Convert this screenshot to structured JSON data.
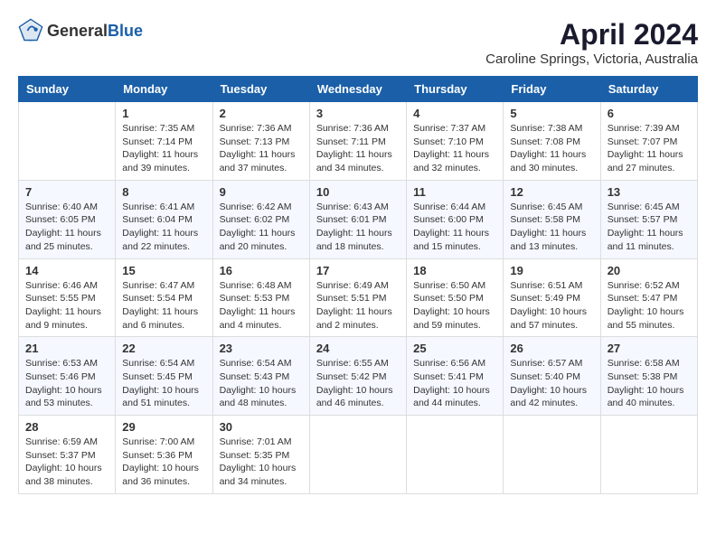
{
  "header": {
    "logo_general": "General",
    "logo_blue": "Blue",
    "month_title": "April 2024",
    "location": "Caroline Springs, Victoria, Australia"
  },
  "days_of_week": [
    "Sunday",
    "Monday",
    "Tuesday",
    "Wednesday",
    "Thursday",
    "Friday",
    "Saturday"
  ],
  "weeks": [
    [
      {
        "day": "",
        "content": ""
      },
      {
        "day": "1",
        "content": "Sunrise: 7:35 AM\nSunset: 7:14 PM\nDaylight: 11 hours\nand 39 minutes."
      },
      {
        "day": "2",
        "content": "Sunrise: 7:36 AM\nSunset: 7:13 PM\nDaylight: 11 hours\nand 37 minutes."
      },
      {
        "day": "3",
        "content": "Sunrise: 7:36 AM\nSunset: 7:11 PM\nDaylight: 11 hours\nand 34 minutes."
      },
      {
        "day": "4",
        "content": "Sunrise: 7:37 AM\nSunset: 7:10 PM\nDaylight: 11 hours\nand 32 minutes."
      },
      {
        "day": "5",
        "content": "Sunrise: 7:38 AM\nSunset: 7:08 PM\nDaylight: 11 hours\nand 30 minutes."
      },
      {
        "day": "6",
        "content": "Sunrise: 7:39 AM\nSunset: 7:07 PM\nDaylight: 11 hours\nand 27 minutes."
      }
    ],
    [
      {
        "day": "7",
        "content": "Sunrise: 6:40 AM\nSunset: 6:05 PM\nDaylight: 11 hours\nand 25 minutes."
      },
      {
        "day": "8",
        "content": "Sunrise: 6:41 AM\nSunset: 6:04 PM\nDaylight: 11 hours\nand 22 minutes."
      },
      {
        "day": "9",
        "content": "Sunrise: 6:42 AM\nSunset: 6:02 PM\nDaylight: 11 hours\nand 20 minutes."
      },
      {
        "day": "10",
        "content": "Sunrise: 6:43 AM\nSunset: 6:01 PM\nDaylight: 11 hours\nand 18 minutes."
      },
      {
        "day": "11",
        "content": "Sunrise: 6:44 AM\nSunset: 6:00 PM\nDaylight: 11 hours\nand 15 minutes."
      },
      {
        "day": "12",
        "content": "Sunrise: 6:45 AM\nSunset: 5:58 PM\nDaylight: 11 hours\nand 13 minutes."
      },
      {
        "day": "13",
        "content": "Sunrise: 6:45 AM\nSunset: 5:57 PM\nDaylight: 11 hours\nand 11 minutes."
      }
    ],
    [
      {
        "day": "14",
        "content": "Sunrise: 6:46 AM\nSunset: 5:55 PM\nDaylight: 11 hours\nand 9 minutes."
      },
      {
        "day": "15",
        "content": "Sunrise: 6:47 AM\nSunset: 5:54 PM\nDaylight: 11 hours\nand 6 minutes."
      },
      {
        "day": "16",
        "content": "Sunrise: 6:48 AM\nSunset: 5:53 PM\nDaylight: 11 hours\nand 4 minutes."
      },
      {
        "day": "17",
        "content": "Sunrise: 6:49 AM\nSunset: 5:51 PM\nDaylight: 11 hours\nand 2 minutes."
      },
      {
        "day": "18",
        "content": "Sunrise: 6:50 AM\nSunset: 5:50 PM\nDaylight: 10 hours\nand 59 minutes."
      },
      {
        "day": "19",
        "content": "Sunrise: 6:51 AM\nSunset: 5:49 PM\nDaylight: 10 hours\nand 57 minutes."
      },
      {
        "day": "20",
        "content": "Sunrise: 6:52 AM\nSunset: 5:47 PM\nDaylight: 10 hours\nand 55 minutes."
      }
    ],
    [
      {
        "day": "21",
        "content": "Sunrise: 6:53 AM\nSunset: 5:46 PM\nDaylight: 10 hours\nand 53 minutes."
      },
      {
        "day": "22",
        "content": "Sunrise: 6:54 AM\nSunset: 5:45 PM\nDaylight: 10 hours\nand 51 minutes."
      },
      {
        "day": "23",
        "content": "Sunrise: 6:54 AM\nSunset: 5:43 PM\nDaylight: 10 hours\nand 48 minutes."
      },
      {
        "day": "24",
        "content": "Sunrise: 6:55 AM\nSunset: 5:42 PM\nDaylight: 10 hours\nand 46 minutes."
      },
      {
        "day": "25",
        "content": "Sunrise: 6:56 AM\nSunset: 5:41 PM\nDaylight: 10 hours\nand 44 minutes."
      },
      {
        "day": "26",
        "content": "Sunrise: 6:57 AM\nSunset: 5:40 PM\nDaylight: 10 hours\nand 42 minutes."
      },
      {
        "day": "27",
        "content": "Sunrise: 6:58 AM\nSunset: 5:38 PM\nDaylight: 10 hours\nand 40 minutes."
      }
    ],
    [
      {
        "day": "28",
        "content": "Sunrise: 6:59 AM\nSunset: 5:37 PM\nDaylight: 10 hours\nand 38 minutes."
      },
      {
        "day": "29",
        "content": "Sunrise: 7:00 AM\nSunset: 5:36 PM\nDaylight: 10 hours\nand 36 minutes."
      },
      {
        "day": "30",
        "content": "Sunrise: 7:01 AM\nSunset: 5:35 PM\nDaylight: 10 hours\nand 34 minutes."
      },
      {
        "day": "",
        "content": ""
      },
      {
        "day": "",
        "content": ""
      },
      {
        "day": "",
        "content": ""
      },
      {
        "day": "",
        "content": ""
      }
    ]
  ]
}
